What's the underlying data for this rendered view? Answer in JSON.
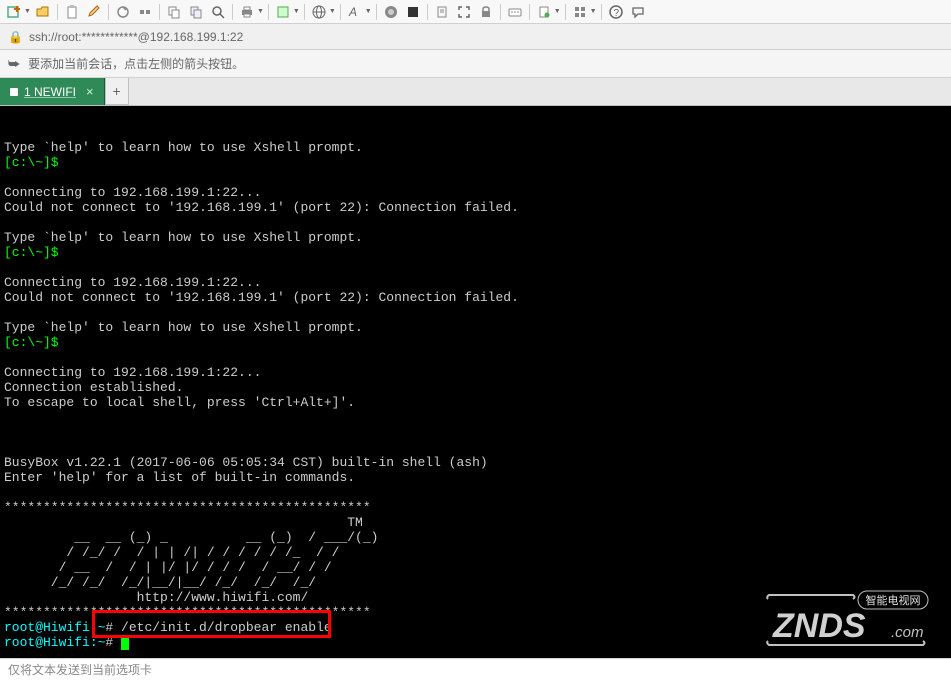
{
  "address_bar": {
    "text": "ssh://root:************@192.168.199.1:22"
  },
  "info_bar": {
    "text": "要添加当前会话，点击左侧的箭头按钮。"
  },
  "tabs": {
    "active": {
      "label": "1 NEWIFI",
      "prefix_underlined": "1"
    }
  },
  "terminal": {
    "prompt_local": "[c:\\~]$",
    "lines": {
      "help1": "Type `help' to learn how to use Xshell prompt.",
      "connecting": "Connecting to 192.168.199.1:22...",
      "conn_fail": "Could not connect to '192.168.199.1' (port 22): Connection failed.",
      "conn_est": "Connection established.",
      "escape": "To escape to local shell, press 'Ctrl+Alt+]'.",
      "busybox": "BusyBox v1.22.1 (2017-06-06 05:05:34 CST) built-in shell (ash)",
      "enter_help": "Enter 'help' for a list of built-in commands.",
      "ascii_sep": "***********************************************",
      "ascii_tm": "                                            TM",
      "ascii_l1": "         __  __ (_) _          __ (_)  / ___/(_)",
      "ascii_l2": "        / /_/ /  / | | /| / / / / / /_  / /",
      "ascii_l3": "       / __  /  / | |/ |/ / / /  / __/ / /",
      "ascii_l4": "      /_/ /_/  /_/|__/|__/ /_/  /_/  /_/",
      "ascii_url": "                 http://www.hiwifi.com/",
      "prompt_hiwifi": "root@Hiwifi:~",
      "hash": "#",
      "cmd": " /etc/init.d/dropbear enable"
    }
  },
  "status_bar": {
    "text": "仅将文本发送到当前选项卡"
  },
  "watermark": {
    "main": "ZNDS",
    "sub": "智能电视网",
    "suffix": ".com"
  },
  "toolbar_icons": [
    "new-session",
    "open",
    "paste",
    "edit",
    "settings",
    "reconnect",
    "disconnect",
    "copy",
    "find",
    "print",
    "capture",
    "encoding",
    "font",
    "color",
    "scroll",
    "lock",
    "fullscreen",
    "keymap",
    "folder",
    "view",
    "help",
    "tips"
  ]
}
